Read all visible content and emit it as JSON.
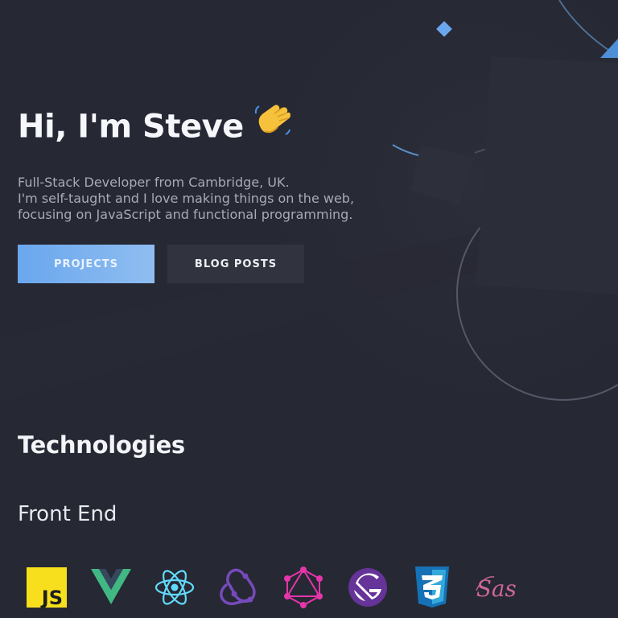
{
  "hero": {
    "title": "Hi, I'm Steve",
    "wave_icon": "waving-hand-icon",
    "lines": [
      "Full-Stack Developer from Cambridge, UK.",
      "I'm self-taught and I love making things on the web,",
      "focusing on JavaScript and functional programming."
    ],
    "buttons": {
      "projects": "PROJECTS",
      "blog": "BLOG POSTS"
    }
  },
  "technologies": {
    "title": "Technologies",
    "front_end": {
      "title": "Front End",
      "icons": [
        "javascript-icon",
        "vue-icon",
        "react-icon",
        "redux-icon",
        "graphql-icon",
        "gatsby-icon",
        "css3-icon",
        "sass-icon"
      ],
      "js_text": "JS",
      "sass_text": "Sass"
    }
  },
  "colors": {
    "background": "#262833",
    "accent": "#6aa7ee",
    "secondary_button": "#31333e"
  }
}
